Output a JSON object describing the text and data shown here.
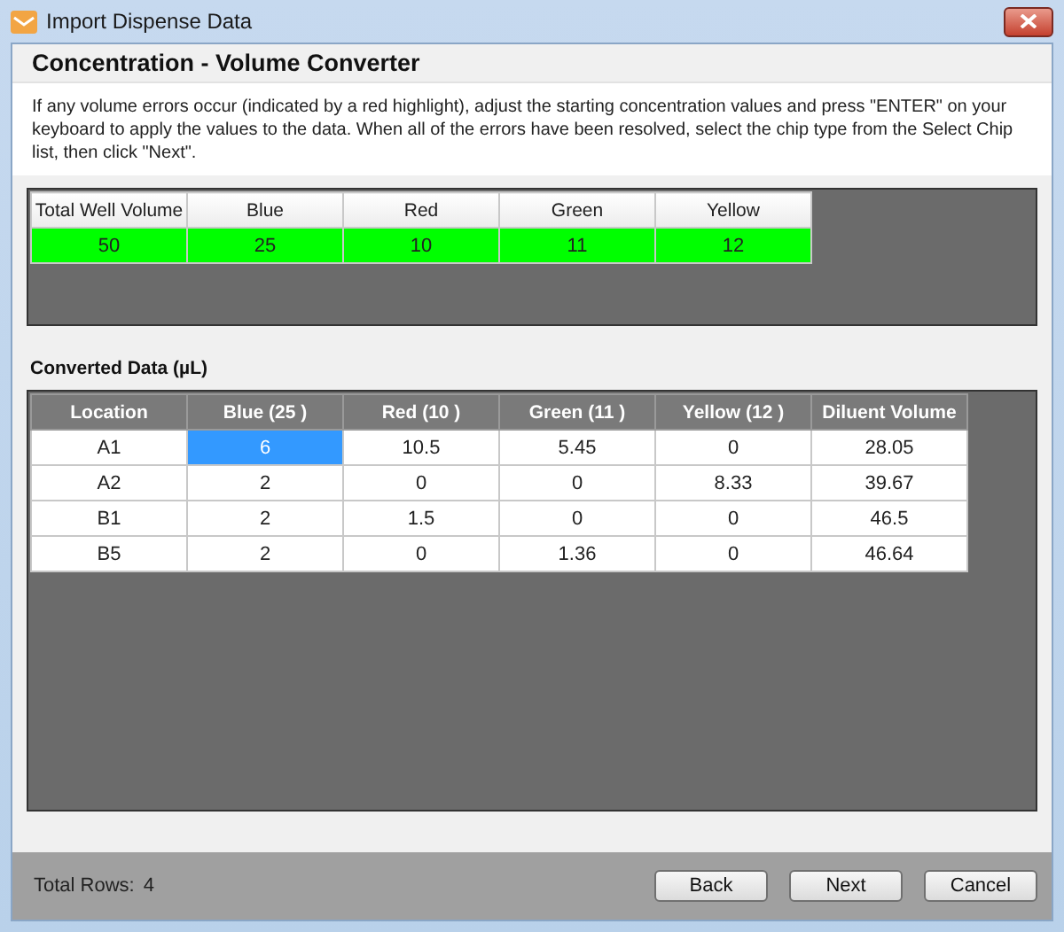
{
  "window": {
    "title": "Import Dispense Data"
  },
  "header": {
    "title": "Concentration - Volume Converter"
  },
  "instructions": "If any volume errors occur (indicated by a red highlight), adjust the starting concentration values and press \"ENTER\" on your keyboard to apply the values to the data. When all of the errors have been resolved, select the chip type from the Select Chip list, then click \"Next\".",
  "concentration_table": {
    "columns": [
      "Total Well Volume",
      "Blue",
      "Red",
      "Green",
      "Yellow"
    ],
    "cells": [
      {
        "text": "50",
        "error": false
      },
      {
        "text": "25",
        "error": false
      },
      {
        "text": "10",
        "error": false
      },
      {
        "text": "11",
        "error": false
      },
      {
        "text": "12",
        "error": false
      }
    ]
  },
  "converted": {
    "title": "Converted Data (µL)",
    "columns": [
      "Location",
      "Blue (25 )",
      "Red (10 )",
      "Green (11 )",
      "Yellow (12 )",
      "Diluent Volume"
    ],
    "rows": [
      {
        "cells": [
          {
            "text": "A1",
            "selected": false
          },
          {
            "text": "6",
            "selected": true
          },
          {
            "text": "10.5",
            "selected": false
          },
          {
            "text": "5.45",
            "selected": false
          },
          {
            "text": "0",
            "selected": false
          },
          {
            "text": "28.05",
            "selected": false
          }
        ]
      },
      {
        "cells": [
          {
            "text": "A2",
            "selected": false
          },
          {
            "text": "2",
            "selected": false
          },
          {
            "text": "0",
            "selected": false
          },
          {
            "text": "0",
            "selected": false
          },
          {
            "text": "8.33",
            "selected": false
          },
          {
            "text": "39.67",
            "selected": false
          }
        ]
      },
      {
        "cells": [
          {
            "text": "B1",
            "selected": false
          },
          {
            "text": "2",
            "selected": false
          },
          {
            "text": "1.5",
            "selected": false
          },
          {
            "text": "0",
            "selected": false
          },
          {
            "text": "0",
            "selected": false
          },
          {
            "text": "46.5",
            "selected": false
          }
        ]
      },
      {
        "cells": [
          {
            "text": "B5",
            "selected": false
          },
          {
            "text": "2",
            "selected": false
          },
          {
            "text": "0",
            "selected": false
          },
          {
            "text": "1.36",
            "selected": false
          },
          {
            "text": "0",
            "selected": false
          },
          {
            "text": "46.64",
            "selected": false
          }
        ]
      }
    ]
  },
  "footer": {
    "total_label": "Total Rows:",
    "total_value": "4",
    "buttons": [
      "Back",
      "Next",
      "Cancel"
    ]
  }
}
